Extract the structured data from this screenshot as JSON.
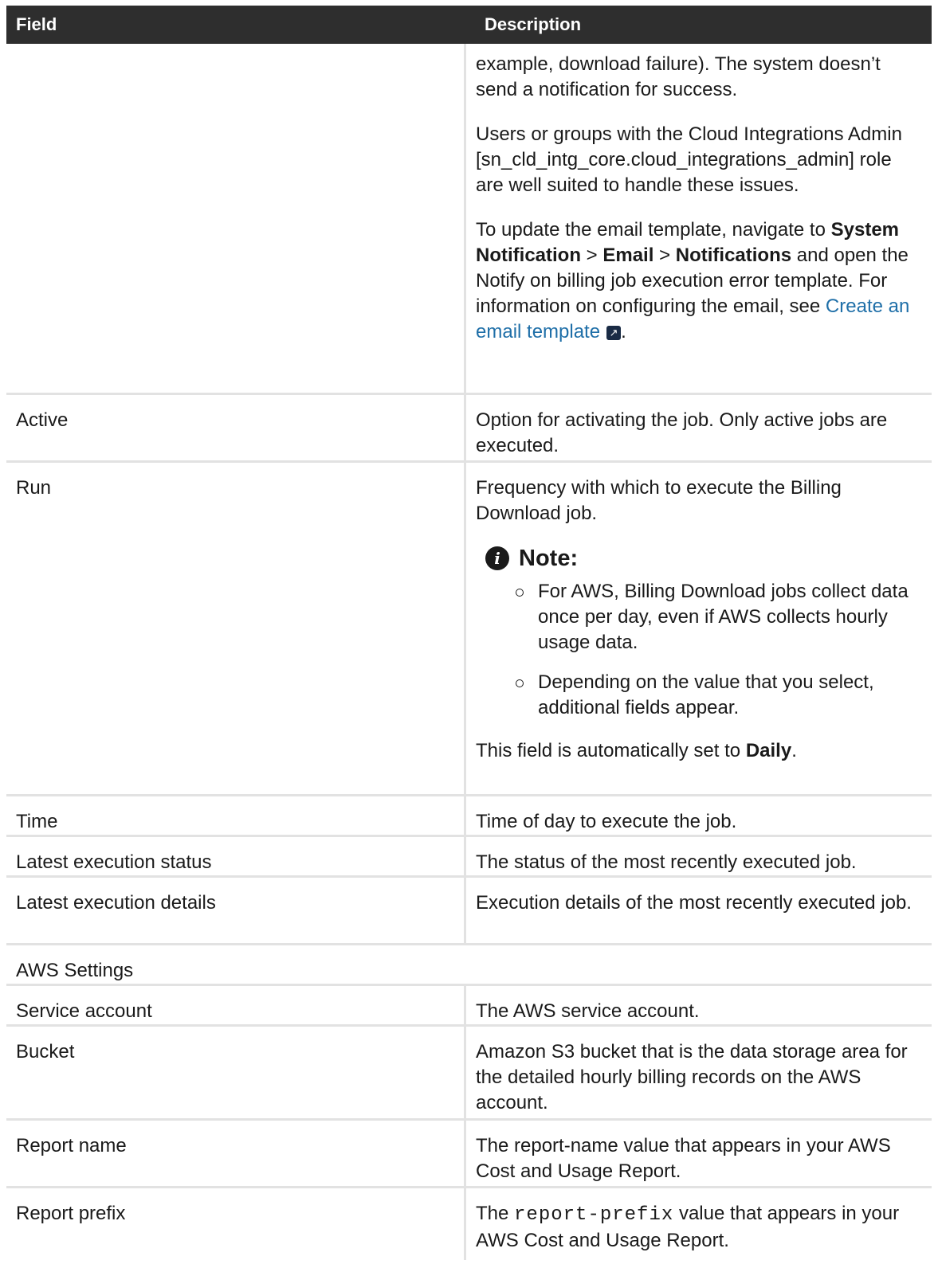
{
  "header": {
    "field": "Field",
    "description": "Description"
  },
  "first_row": {
    "p1": "example, download failure). The system doesn’t send a notification for success.",
    "p2": "Users or groups with the Cloud Integrations Admin [sn_cld_intg_core.cloud_integrations_admin] role are well suited to handle these issues.",
    "p3_a": "To update the email template, navigate to",
    "p3_b1": "System Notification",
    "p3_sep1": ">",
    "p3_b2": "Email",
    "p3_sep2": ">",
    "p3_b3": "Notifications",
    "p3_c": "and open the Notify on billing job execution error template. For information on configuring the email, see",
    "p3_link": "Create an email template",
    "p3_end": "."
  },
  "active": {
    "field": "Active",
    "description": "Option for activating the job. Only active jobs are executed."
  },
  "run": {
    "field": "Run",
    "description": "Frequency with which to execute the Billing Download job.",
    "note_title": "Note:",
    "note_items": [
      "For AWS, Billing Download jobs collect data once per day, even if AWS collects hourly usage data.",
      "Depending on the value that you select, additional fields appear."
    ],
    "auto_a": "This field is automatically set to",
    "auto_b": "Daily",
    "auto_c": "."
  },
  "time": {
    "field": "Time",
    "description": "Time of day to execute the job."
  },
  "latest_status": {
    "field": "Latest execution status",
    "description": "The status of the most recently executed job."
  },
  "latest_details": {
    "field": "Latest execution details",
    "description": "Execution details of the most recently executed job."
  },
  "aws_settings": {
    "label": "AWS Settings"
  },
  "service_account": {
    "field": "Service account",
    "description": "The AWS service account."
  },
  "bucket": {
    "field": "Bucket",
    "description": "Amazon S3 bucket that is the data storage area for the detailed hourly billing records on the AWS account."
  },
  "report_name": {
    "field": "Report name",
    "description": "The report-name value that appears in your AWS Cost and Usage Report."
  },
  "report_prefix": {
    "field": "Report prefix",
    "description_a": "The",
    "description_code": "report-prefix",
    "description_b": "value that appears in your AWS Cost and Usage Report."
  }
}
